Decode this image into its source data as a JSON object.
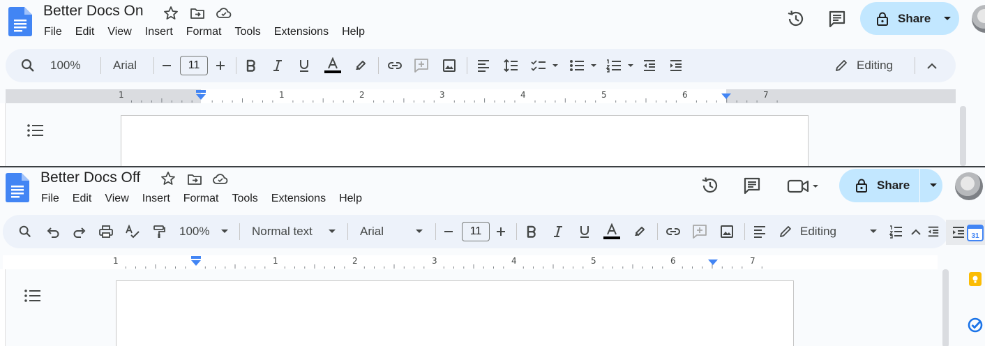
{
  "top_window": {
    "title": "Better Docs On",
    "menu": [
      "File",
      "Edit",
      "View",
      "Insert",
      "Format",
      "Tools",
      "Extensions",
      "Help"
    ],
    "share_label": "Share",
    "toolbar": {
      "zoom": "100%",
      "font": "Arial",
      "font_size": "11",
      "mode": "Editing"
    },
    "ruler_numbers": [
      "1",
      "1",
      "2",
      "3",
      "4",
      "5",
      "6",
      "7"
    ]
  },
  "bottom_window": {
    "title": "Better Docs Off",
    "menu": [
      "File",
      "Edit",
      "View",
      "Insert",
      "Format",
      "Tools",
      "Extensions",
      "Help"
    ],
    "share_label": "Share",
    "toolbar": {
      "zoom": "100%",
      "style": "Normal text",
      "font": "Arial",
      "font_size": "11",
      "mode": "Editing"
    },
    "ruler_numbers": [
      "1",
      "1",
      "2",
      "3",
      "4",
      "5",
      "6",
      "7"
    ],
    "calendar_day": "31"
  },
  "colors": {
    "docs_blue": "#4285f4",
    "share_bg": "#c2e7ff",
    "toolbar_bg": "#edf2fa",
    "ruler_marker": "#4285f4",
    "keep_yellow": "#fbbc04",
    "tasks_blue": "#1a73e8"
  }
}
